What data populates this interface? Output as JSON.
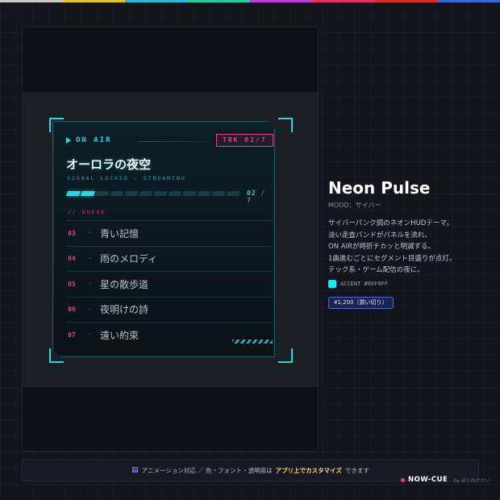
{
  "colors": {
    "accent": "#00f0ff",
    "cyan": "#2ad6e0",
    "pink": "#e0417f",
    "background": "#13141c",
    "rainbow": [
      "#c9c9c9",
      "#e8c420",
      "#25b8d8",
      "#1fd2a0",
      "#c23ad8",
      "#e63060",
      "#e02828",
      "#3a6ad8"
    ]
  },
  "hud": {
    "on_air": "ON AIR",
    "play_icon": "play-icon",
    "track_badge": "TRK 02/7",
    "title": "オーロラの夜空",
    "subtitle": "SIGNAL LOCKED — STREAMING",
    "progress": {
      "current": "02",
      "separator": "/",
      "total": "7",
      "segments_total": 12,
      "segments_lit": 2
    },
    "queue_label": "// QUEUE",
    "queue": [
      {
        "num": "03",
        "dot": "·",
        "title": "青い記憶"
      },
      {
        "num": "04",
        "dot": "·",
        "title": "雨のメロディ"
      },
      {
        "num": "05",
        "dot": "·",
        "title": "星の散歩道"
      },
      {
        "num": "06",
        "dot": "·",
        "title": "夜明けの詩"
      },
      {
        "num": "07",
        "dot": "·",
        "title": "遠い約束"
      }
    ]
  },
  "info": {
    "name": "Neon Pulse",
    "mood": "MOOD：サイバー",
    "description": [
      "サイバーパンク調のネオンHUDテーマ。",
      "淡い走査バンドがパネルを流れ、",
      "ON AIRが時折チカッと明滅する。",
      "1曲進むごとにセグメント目盛りが点灯。",
      "テック系・ゲーム配信の夜に。"
    ],
    "accent_label": "ACCENT #00F0FF",
    "price": "¥1,200（買い切り）"
  },
  "footer": {
    "icon": "brush-icon",
    "text_before": "アニメーション対応 ／ 色・フォント・透明度は",
    "text_highlight": "アプリ上でカスタマイズ",
    "text_after": "できます"
  },
  "brand": {
    "name": "NOW-CUE",
    "by": "by ぽくのかだい"
  }
}
